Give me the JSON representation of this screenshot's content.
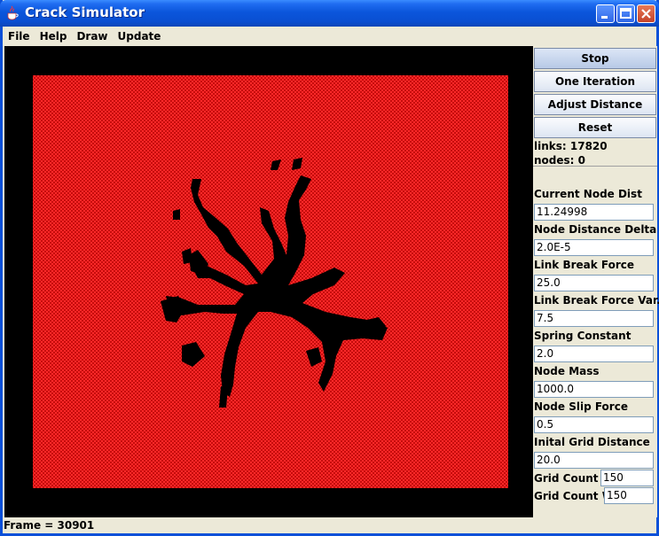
{
  "window": {
    "title": "Crack Simulator"
  },
  "menu": {
    "items": [
      "File",
      "Help",
      "Draw",
      "Update"
    ]
  },
  "controls": {
    "stop_label": "Stop",
    "one_iteration_label": "One Iteration",
    "adjust_distance_label": "Adjust Distance",
    "reset_label": "Reset"
  },
  "stats": {
    "links": "links: 17820",
    "nodes": "nodes: 0"
  },
  "params": {
    "current_node_dist": {
      "label": "Current Node Dist",
      "value": "11.24998"
    },
    "node_distance_delta": {
      "label": "Node Distance Delta",
      "value": "2.0E-5"
    },
    "link_break_force": {
      "label": "Link Break Force",
      "value": "25.0"
    },
    "link_break_force_var": {
      "label": "Link Break Force Var.",
      "value": "7.5"
    },
    "spring_constant": {
      "label": "Spring Constant",
      "value": "2.0"
    },
    "node_mass": {
      "label": "Node Mass",
      "value": "1000.0"
    },
    "node_slip_force": {
      "label": "Node Slip Force",
      "value": "0.5"
    },
    "initial_grid_distance": {
      "label": "Inital Grid Distance",
      "value": "20.0"
    },
    "grid_count_h": {
      "label": "Grid Count H",
      "value": "150"
    },
    "grid_count_w": {
      "label": "Grid Count W",
      "value": "150"
    }
  },
  "status": {
    "frame": "Frame = 30901"
  },
  "colors": {
    "mesh": "#E01010",
    "background": "#000000",
    "title_bar": "#0A56DC"
  }
}
